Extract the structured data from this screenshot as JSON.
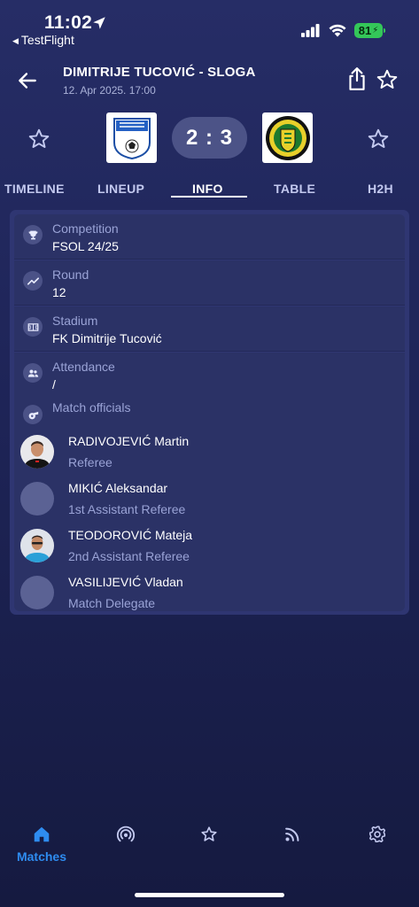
{
  "status_bar": {
    "time": "11:02",
    "back_app": "TestFlight",
    "battery": "81"
  },
  "header": {
    "title": "DIMITRIJE TUCOVIĆ - SLOGA",
    "date": "12. Apr 2025. 17:00"
  },
  "score": {
    "home": "2",
    "separator": ":",
    "away": "3",
    "display": "2 : 3"
  },
  "tabs": [
    {
      "label": "TIMELINE",
      "active": false
    },
    {
      "label": "LINEUP",
      "active": false
    },
    {
      "label": "INFO",
      "active": true
    },
    {
      "label": "TABLE",
      "active": false
    },
    {
      "label": "H2H",
      "active": false
    }
  ],
  "info": {
    "competition": {
      "label": "Competition",
      "value": "FSOL 24/25",
      "icon": "trophy-icon"
    },
    "round": {
      "label": "Round",
      "value": "12",
      "icon": "trend-icon"
    },
    "stadium": {
      "label": "Stadium",
      "value": "FK Dimitrije Tucović",
      "icon": "stadium-icon"
    },
    "attendance": {
      "label": "Attendance",
      "value": "/",
      "icon": "people-icon"
    },
    "officials_label": "Match officials"
  },
  "officials": [
    {
      "name": "RADIVOJEVIĆ Martin",
      "role": "Referee",
      "has_photo": true
    },
    {
      "name": "MIKIĆ Aleksandar",
      "role": "1st Assistant Referee",
      "has_photo": false
    },
    {
      "name": "TEODOROVIĆ Mateja",
      "role": "2nd Assistant Referee",
      "has_photo": true
    },
    {
      "name": "VASILIJEVIĆ Vladan",
      "role": "Match Delegate",
      "has_photo": false
    }
  ],
  "bottom_nav": [
    {
      "label": "Matches",
      "icon": "home-icon",
      "active": true
    },
    {
      "label": "",
      "icon": "live-icon",
      "active": false
    },
    {
      "label": "",
      "icon": "star-icon",
      "active": false
    },
    {
      "label": "",
      "icon": "rss-icon",
      "active": false
    },
    {
      "label": "",
      "icon": "settings-icon",
      "active": false
    }
  ],
  "colors": {
    "background": "#1e2457",
    "card": "#2f3672",
    "accent": "#2e8cf0",
    "score_pill": "#4c5387",
    "battery": "#34c759"
  }
}
